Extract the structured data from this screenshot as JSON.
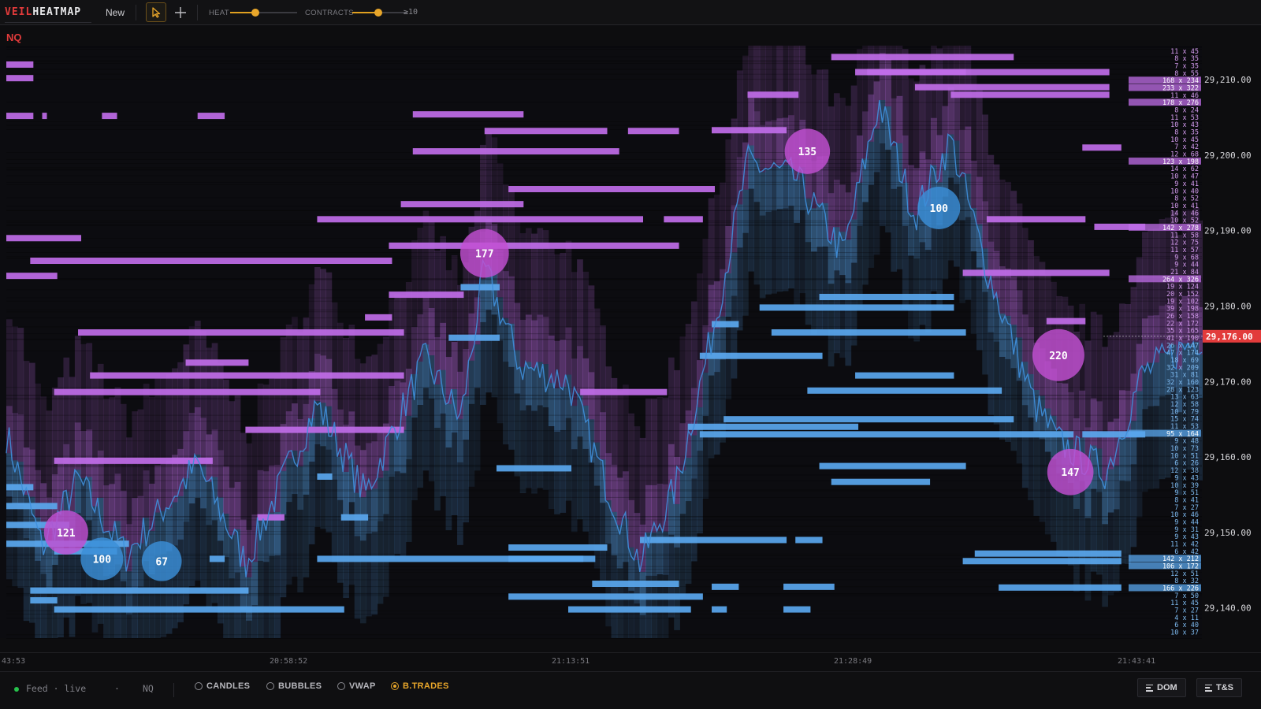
{
  "app": {
    "logo_part1": "VEIL",
    "logo_part2": "HEATMAP",
    "new_label": "New"
  },
  "toolbar": {
    "heat_label": "HEAT",
    "heat_level": 0.38,
    "contracts_label": "CONTRACTS",
    "contracts_level": 0.47,
    "contracts_value": "≥10"
  },
  "symbol": "NQ",
  "colors": {
    "background": "#0d0d0f",
    "bid": "#5aa7ee",
    "ask": "#c06de8",
    "last_price": "#e23b3b",
    "accent": "#e8a62a",
    "price_line": "#3f8fdc"
  },
  "price_axis": {
    "labels": [
      "29,210.00",
      "29,200.00",
      "29,190.00",
      "29,180.00",
      "29,170.00",
      "29,160.00",
      "29,150.00",
      "29,140.00"
    ],
    "values": [
      29210,
      29200,
      29190,
      29180,
      29170,
      29160,
      29150,
      29140
    ],
    "current_price": "29,176.00"
  },
  "time_axis": [
    "43:53",
    "20:58:52",
    "21:13:51",
    "21:28:49",
    "21:43:41"
  ],
  "book_levels": {
    "ask": [
      "11 x 45",
      "8 x 35",
      "7 x 35",
      "8 x 55",
      "168 x 234",
      "233 x 322",
      "11 x 46",
      "178 x 276",
      "8 x 24",
      "11 x 53",
      "10 x 43",
      "8 x 35",
      "10 x 45",
      "7 x 42",
      "12 x 68",
      "123 x 198",
      "14 x 62",
      "10 x 47",
      "9 x 41",
      "10 x 40",
      "8 x 52",
      "10 x 41",
      "14 x 46",
      "10 x 52",
      "142 x 278",
      "11 x 58",
      "12 x 75",
      "11 x 57",
      "9 x 68",
      "9 x 44",
      "21 x 84",
      "264 x 326",
      "19 x 124",
      "20 x 152",
      "19 x 102",
      "39 x 198",
      "26 x 158",
      "22 x 172",
      "35 x 165",
      "41 x 190"
    ],
    "bid": [
      "26 x 147",
      "47 x 174",
      "18 x 69",
      "32 x 209",
      "31 x 81",
      "32 x 160",
      "28 x 123",
      "13 x 63",
      "12 x 58",
      "10 x 79",
      "15 x 74",
      "11 x 53",
      "95 x 164",
      "9 x 48",
      "10 x 73",
      "10 x 51",
      "6 x 26",
      "12 x 38",
      "9 x 43",
      "10 x 39",
      "9 x 51",
      "8 x 41",
      "7 x 27",
      "10 x 46",
      "9 x 44",
      "9 x 31",
      "9 x 43",
      "11 x 42",
      "6 x 42",
      "142 x 212",
      "106 x 172",
      "12 x 51",
      "8 x 32",
      "166 x 226",
      "7 x 50",
      "11 x 45",
      "7 x 27",
      "4 x 11",
      "6 x 40",
      "10 x 37"
    ]
  },
  "trade_bubbles": [
    {
      "label": "121",
      "side": "sell",
      "time": 0.05,
      "price": 29150.0
    },
    {
      "label": "100",
      "side": "buy",
      "time": 0.08,
      "price": 29146.5
    },
    {
      "label": "67",
      "side": "buy",
      "time": 0.13,
      "price": 29146.2
    },
    {
      "label": "177",
      "side": "sell",
      "time": 0.4,
      "price": 29187.0
    },
    {
      "label": "135",
      "side": "sell",
      "time": 0.67,
      "price": 29200.5
    },
    {
      "label": "100",
      "side": "buy",
      "time": 0.78,
      "price": 29193.0
    },
    {
      "label": "220",
      "side": "sell",
      "time": 0.88,
      "price": 29173.5
    },
    {
      "label": "147",
      "side": "sell",
      "time": 0.89,
      "price": 29158.0
    }
  ],
  "bottom": {
    "feed_label": "Feed · live",
    "separator": "·",
    "symbol": "NQ",
    "toggles": [
      {
        "label": "CANDLES",
        "checked": false
      },
      {
        "label": "BUBBLES",
        "checked": false
      },
      {
        "label": "VWAP",
        "checked": false
      },
      {
        "label": "B.TRADES",
        "checked": true
      }
    ],
    "dom_label": "DOM",
    "ts_label": "T&S"
  }
}
